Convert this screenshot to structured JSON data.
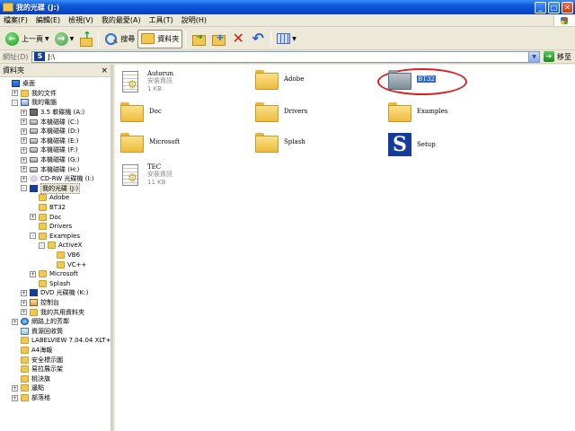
{
  "window": {
    "title": "我的光碟 (J:)",
    "min_label": "_",
    "max_label": "□",
    "close_label": "✕"
  },
  "menu": [
    "檔案(F)",
    "編輯(E)",
    "檢視(V)",
    "我的最愛(A)",
    "工具(T)",
    "說明(H)"
  ],
  "toolbar": {
    "back_label": "上一頁",
    "search_label": "搜尋",
    "folders_label": "資料夾"
  },
  "address": {
    "label": "網址(D)",
    "value": "J:\\",
    "go_label": "移至"
  },
  "left_pane": {
    "header": "資料夾",
    "close_label": "×",
    "tree": [
      {
        "label": "桌面",
        "indent": 0,
        "icon": "desktop-icon",
        "exp": ""
      },
      {
        "label": "我的文件",
        "indent": 1,
        "icon": "folder-icon",
        "exp": "+"
      },
      {
        "label": "我的電腦",
        "indent": 1,
        "icon": "computer-icon",
        "exp": "-"
      },
      {
        "label": "3.5 軟碟機 (A:)",
        "indent": 2,
        "icon": "floppy-icon",
        "exp": "+"
      },
      {
        "label": "本機磁碟 (C:)",
        "indent": 2,
        "icon": "drive-icon",
        "exp": "+"
      },
      {
        "label": "本機磁碟 (D:)",
        "indent": 2,
        "icon": "drive-icon",
        "exp": "+"
      },
      {
        "label": "本機磁碟 (E:)",
        "indent": 2,
        "icon": "drive-icon",
        "exp": "+"
      },
      {
        "label": "本機磁碟 (F:)",
        "indent": 2,
        "icon": "drive-icon",
        "exp": "+"
      },
      {
        "label": "本機磁碟 (G:)",
        "indent": 2,
        "icon": "drive-icon",
        "exp": "+"
      },
      {
        "label": "本機磁碟 (H:)",
        "indent": 2,
        "icon": "drive-icon",
        "exp": "+"
      },
      {
        "label": "CD-RW 光碟機 (I:)",
        "indent": 2,
        "icon": "cdrom-icon",
        "exp": "+"
      },
      {
        "label": "我的光碟 (J:)",
        "indent": 2,
        "icon": "special-drive-icon",
        "exp": "-",
        "selected": true
      },
      {
        "label": "Adobe",
        "indent": 3,
        "icon": "folder-icon",
        "exp": ""
      },
      {
        "label": "BT32",
        "indent": 3,
        "icon": "folder-icon",
        "exp": ""
      },
      {
        "label": "Doc",
        "indent": 3,
        "icon": "folder-icon",
        "exp": "+"
      },
      {
        "label": "Drivers",
        "indent": 3,
        "icon": "folder-icon",
        "exp": ""
      },
      {
        "label": "Examples",
        "indent": 3,
        "icon": "folder-icon",
        "exp": "-"
      },
      {
        "label": "ActiveX",
        "indent": 4,
        "icon": "folder-icon",
        "exp": "-"
      },
      {
        "label": "VB6",
        "indent": 5,
        "icon": "folder-icon",
        "exp": ""
      },
      {
        "label": "VC++",
        "indent": 5,
        "icon": "folder-icon",
        "exp": ""
      },
      {
        "label": "Microsoft",
        "indent": 3,
        "icon": "folder-icon",
        "exp": "+"
      },
      {
        "label": "Splash",
        "indent": 3,
        "icon": "folder-icon",
        "exp": ""
      },
      {
        "label": "DVD 光碟機 (K:)",
        "indent": 2,
        "icon": "dvd-icon",
        "exp": "+"
      },
      {
        "label": "控制台",
        "indent": 2,
        "icon": "control-panel-icon",
        "exp": "+"
      },
      {
        "label": "我的共用資料夾",
        "indent": 2,
        "icon": "folder-icon",
        "exp": "+"
      },
      {
        "label": "網路上的芳鄰",
        "indent": 1,
        "icon": "network-icon",
        "exp": "+"
      },
      {
        "label": "資源回收筒",
        "indent": 1,
        "icon": "recycle-bin-icon",
        "exp": ""
      },
      {
        "label": "LABELVIEW 7.04.04 XLT+",
        "indent": 1,
        "icon": "folder-icon",
        "exp": ""
      },
      {
        "label": "A4海報",
        "indent": 1,
        "icon": "folder-icon",
        "exp": ""
      },
      {
        "label": "安全標示圖",
        "indent": 1,
        "icon": "folder-icon",
        "exp": ""
      },
      {
        "label": "易拉展示架",
        "indent": 1,
        "icon": "folder-icon",
        "exp": ""
      },
      {
        "label": "桃決旗",
        "indent": 1,
        "icon": "folder-icon",
        "exp": ""
      },
      {
        "label": "邊點",
        "indent": 1,
        "icon": "folder-icon",
        "exp": "+"
      },
      {
        "label": "部落格",
        "indent": 1,
        "icon": "folder-icon",
        "exp": "+"
      }
    ]
  },
  "files": [
    {
      "name": "Autorun",
      "type": "安裝資訊",
      "size": "1 KB",
      "kind": "inf"
    },
    {
      "name": "Adobe",
      "kind": "folder"
    },
    {
      "name": "BT32",
      "kind": "folder",
      "selected": true
    },
    {
      "name": "Doc",
      "kind": "folder"
    },
    {
      "name": "Drivers",
      "kind": "folder"
    },
    {
      "name": "Examples",
      "kind": "folder"
    },
    {
      "name": "Microsoft",
      "kind": "folder"
    },
    {
      "name": "Splash",
      "kind": "folder"
    },
    {
      "name": "Setup",
      "kind": "setup"
    },
    {
      "name": "TEC",
      "type": "安裝資訊",
      "size": "11 KB",
      "kind": "inf"
    }
  ],
  "colors": {
    "highlight_ellipse": "#d82020",
    "selection": "#316ac5"
  }
}
